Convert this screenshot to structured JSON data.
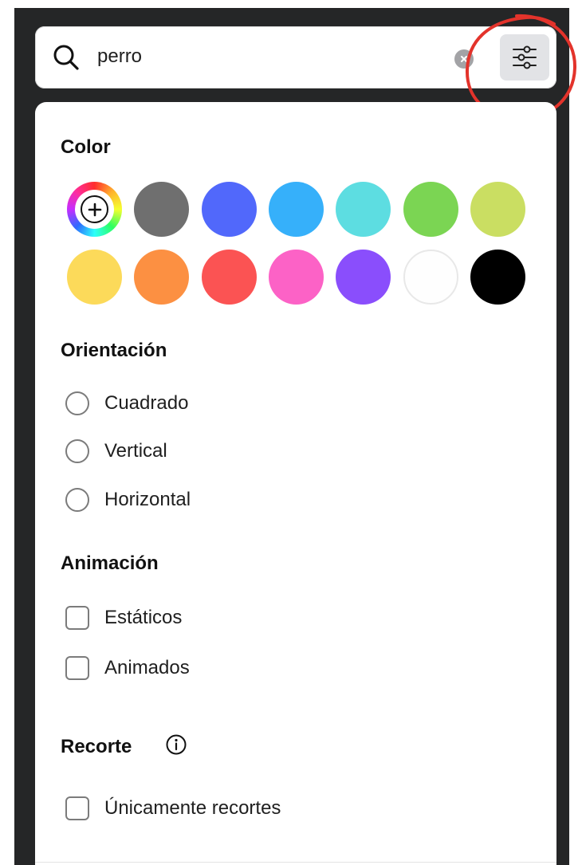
{
  "search": {
    "value": "perro",
    "icon": "search-icon",
    "clear_icon": "clear-icon",
    "filter_icon": "sliders-icon"
  },
  "filters": {
    "color": {
      "title": "Color",
      "add_icon": "plus-icon",
      "swatches": [
        "#6f6f6f",
        "#5168fb",
        "#36b0fa",
        "#5ddde1",
        "#7bd553",
        "#cade62",
        "#fcda5a",
        "#fc9042",
        "#fb5353",
        "#fc62c6",
        "#8a4efc",
        "#fefefe",
        "#000000"
      ]
    },
    "orientation": {
      "title": "Orientación",
      "options": [
        "Cuadrado",
        "Vertical",
        "Horizontal"
      ]
    },
    "animation": {
      "title": "Animación",
      "options": [
        "Estáticos",
        "Animados"
      ]
    },
    "cutout": {
      "title": "Recorte",
      "info_icon": "info-icon",
      "options": [
        "Únicamente recortes"
      ]
    }
  },
  "colors": {
    "highlight_ring": "#e3332b",
    "background": "#252627"
  }
}
